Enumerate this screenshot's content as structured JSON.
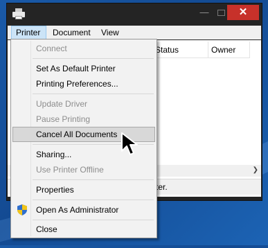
{
  "menubar": {
    "items": [
      "Printer",
      "Document",
      "View"
    ]
  },
  "columns": {
    "status": "Status",
    "owner": "Owner"
  },
  "statusbar": {
    "text": "ter."
  },
  "printer_menu": {
    "items": [
      {
        "label": "Connect",
        "enabled": false
      },
      {
        "label": "Set As Default Printer",
        "enabled": true
      },
      {
        "label": "Printing Preferences...",
        "enabled": true
      },
      {
        "label": "Update Driver",
        "enabled": false
      },
      {
        "label": "Pause Printing",
        "enabled": false
      },
      {
        "label": "Cancel All Documents",
        "enabled": true,
        "highlighted": true
      },
      {
        "label": "Sharing...",
        "enabled": true
      },
      {
        "label": "Use Printer Offline",
        "enabled": false
      },
      {
        "label": "Properties",
        "enabled": true
      },
      {
        "label": "Open As Administrator",
        "enabled": true,
        "icon": "uac-shield-icon"
      },
      {
        "label": "Close",
        "enabled": true
      }
    ]
  },
  "colors": {
    "close_button": "#c7312a",
    "menu_highlight": "#d8d8d8",
    "active_menu_title": "#cce4f7",
    "desktop": "#1a5aa8"
  }
}
